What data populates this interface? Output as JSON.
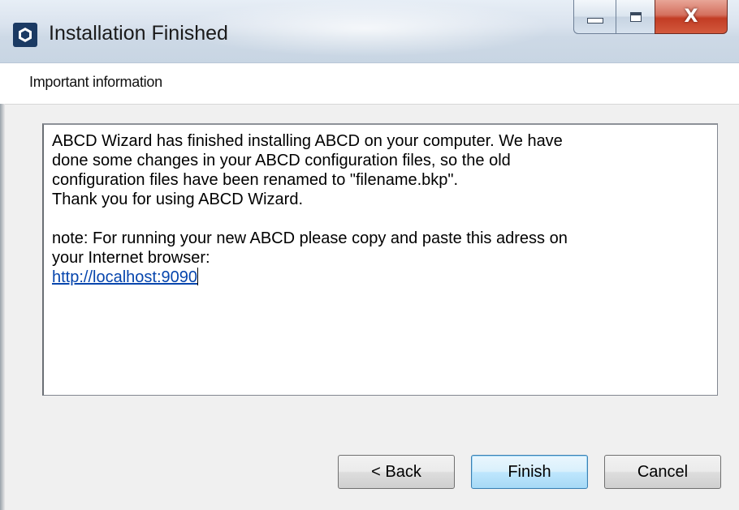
{
  "window": {
    "title": "Installation Finished",
    "icon": "app-hexagon-icon",
    "controls": {
      "minimize_icon": "minimize-icon",
      "maximize_icon": "maximize-icon",
      "close_label": "X"
    }
  },
  "header": {
    "label": "Important information"
  },
  "info": {
    "paragraph1": "ABCD Wizard has finished installing ABCD on your computer. We have\ndone some changes in your ABCD configuration files, so the old\nconfiguration files have been renamed to \"filename.bkp\".\n Thank you for using ABCD Wizard.",
    "paragraph2": "note: For running your new ABCD please copy and paste this adress on\nyour Internet browser:",
    "link": "http://localhost:9090"
  },
  "buttons": {
    "back": "< Back",
    "finish": "Finish",
    "cancel": "Cancel"
  },
  "colors": {
    "link": "#0645ad",
    "close_button": "#c23c24",
    "default_button_border": "#3c7fb1"
  }
}
